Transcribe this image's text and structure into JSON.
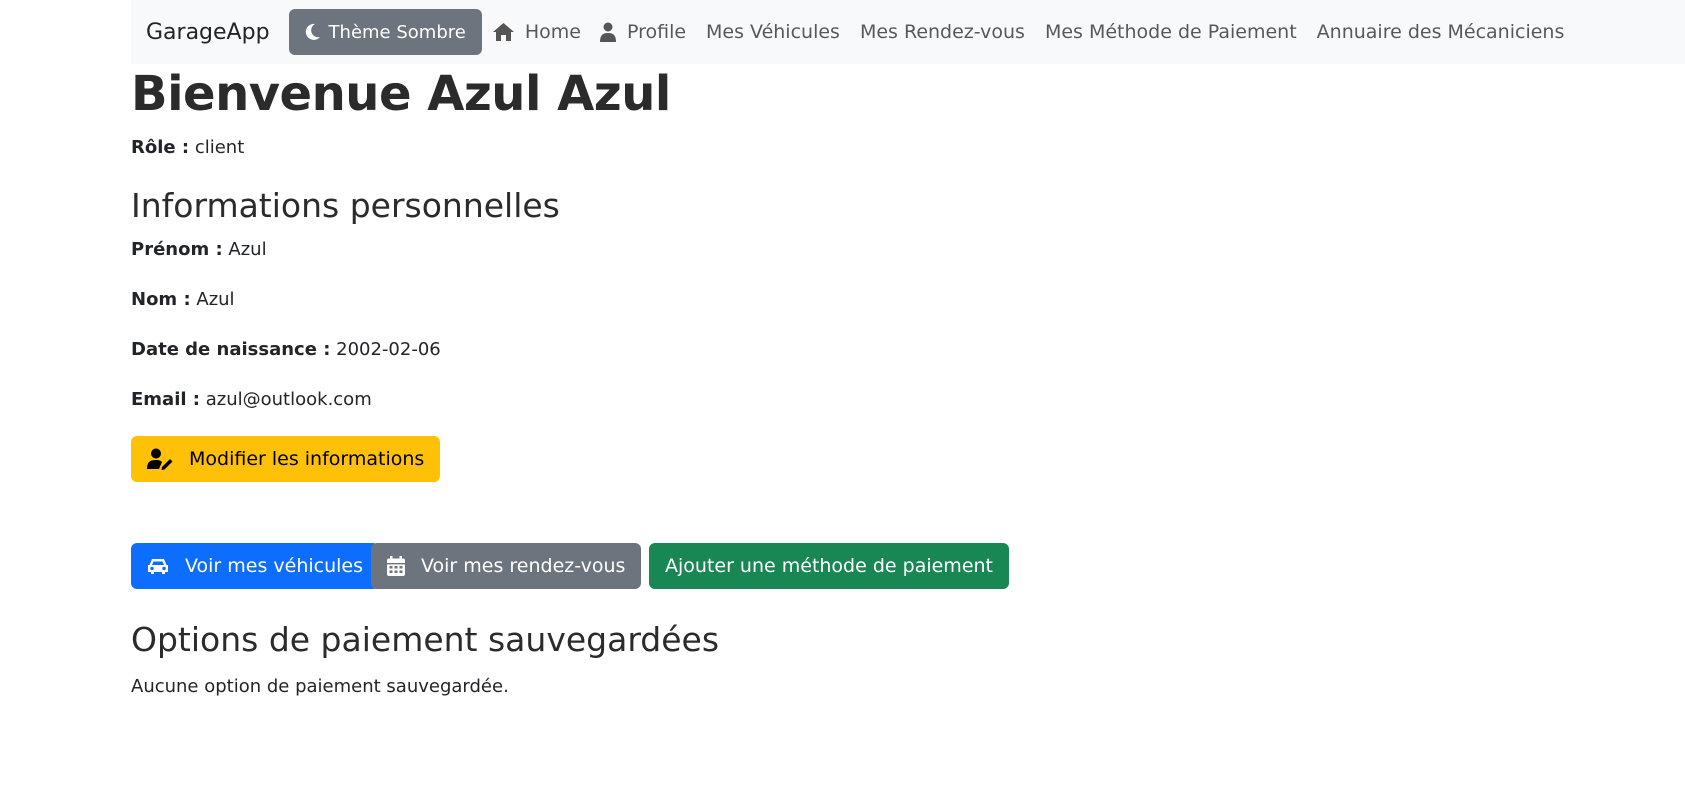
{
  "navbar": {
    "brand": "GarageApp",
    "theme_toggle": "Thème Sombre",
    "links": [
      {
        "label": "Home",
        "icon": "home-icon"
      },
      {
        "label": "Profile",
        "icon": "user-icon"
      },
      {
        "label": "Mes Véhicules"
      },
      {
        "label": "Mes Rendez-vous"
      },
      {
        "label": "Mes Méthode de Paiement"
      },
      {
        "label": "Annuaire des Mécaniciens"
      }
    ]
  },
  "page": {
    "title": "Bienvenue Azul Azul",
    "role_label": "Rôle :",
    "role_value": "client"
  },
  "personal_info": {
    "heading": "Informations personnelles",
    "fields": [
      {
        "label": "Prénom :",
        "value": "Azul"
      },
      {
        "label": "Nom :",
        "value": "Azul"
      },
      {
        "label": "Date de naissance :",
        "value": "2002-02-06"
      },
      {
        "label": "Email :",
        "value": "azul@outlook.com"
      }
    ],
    "edit_button": "Modifier les informations"
  },
  "actions": {
    "vehicles_button": "Voir mes véhicules",
    "appointments_button": "Voir mes rendez-vous",
    "add_payment_button": "Ajouter une méthode de paiement"
  },
  "payment_options": {
    "heading": "Options de paiement sauvegardées",
    "empty_message": "Aucune option de paiement sauvegardée."
  },
  "colors": {
    "navbar_bg": "#f8f9fa",
    "secondary": "#6c757d",
    "warning": "#ffc107",
    "primary": "#0d6efd",
    "success": "#198754"
  }
}
